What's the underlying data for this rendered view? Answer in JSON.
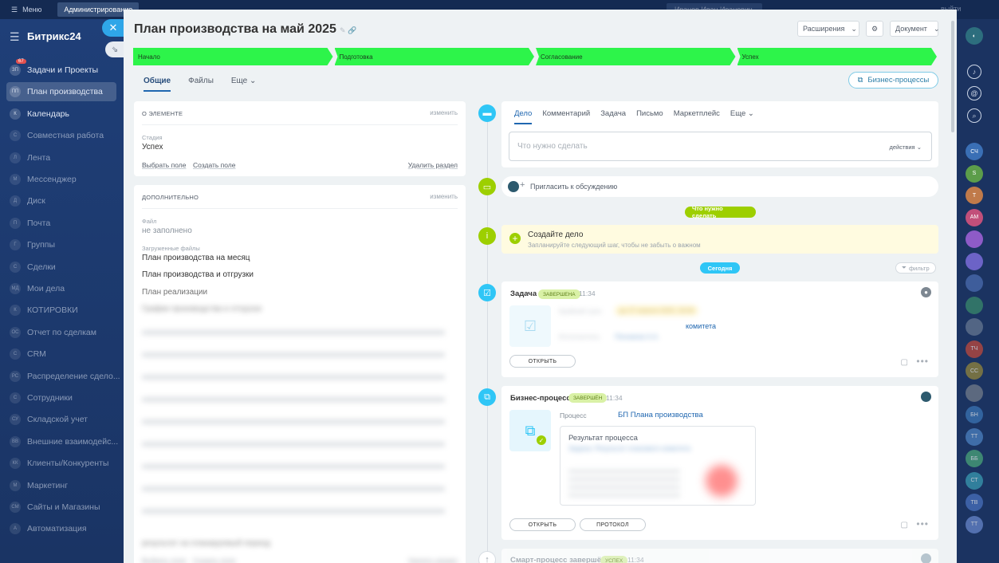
{
  "topbar": {
    "menu": "Меню",
    "admin": "Администрирование",
    "user": "Иванов Иван Иванович",
    "right_text": "выйти"
  },
  "leftnav": {
    "logo": "Битрикс24",
    "items": [
      {
        "label": "Задачи и Проекты",
        "badge": "67",
        "icon": "ЗП"
      },
      {
        "label": "План производства",
        "icon": "ПП",
        "active": true
      },
      {
        "label": "Календарь",
        "icon": "К"
      },
      {
        "label": "Совместная работа",
        "icon": "С"
      },
      {
        "label": "Лента",
        "icon": "Л"
      },
      {
        "label": "Мессенджер",
        "icon": "М"
      },
      {
        "label": "Диск",
        "icon": "Д"
      },
      {
        "label": "Почта",
        "icon": "П"
      },
      {
        "label": "Группы",
        "icon": "Г"
      },
      {
        "label": "Сделки",
        "icon": "С"
      },
      {
        "label": "Мои дела",
        "icon": "МД"
      },
      {
        "label": "КОТИРОВКИ",
        "icon": "К"
      },
      {
        "label": "Отчет по сделкам",
        "icon": "ОС"
      },
      {
        "label": "CRM",
        "icon": "C"
      },
      {
        "label": "Распределение сдело...",
        "icon": "РС"
      },
      {
        "label": "Сотрудники",
        "icon": "С"
      },
      {
        "label": "Складской учет",
        "icon": "СУ"
      },
      {
        "label": "Внешние взаимодейс...",
        "icon": "ВВ"
      },
      {
        "label": "Клиенты/Конкуренты",
        "icon": "КК"
      },
      {
        "label": "Маркетинг",
        "icon": "М"
      },
      {
        "label": "Сайты и Магазины",
        "icon": "СМ"
      },
      {
        "label": "Автоматизация",
        "icon": "А"
      }
    ]
  },
  "header": {
    "title": "План производства на май 2025",
    "ext_btn": "Расширения",
    "doc_btn": "Документ"
  },
  "stages": [
    "Начало",
    "Подготовка",
    "Согласование",
    "Успех"
  ],
  "tabs": {
    "general": "Общие",
    "files": "Файлы",
    "more": "Еще"
  },
  "bp_button": "Бизнес-процессы",
  "about": {
    "header": "О ЭЛЕМЕНТЕ",
    "edit": "изменить",
    "stage_label": "Стадия",
    "stage_value": "Успех",
    "choose": "Выбрать поле",
    "create": "Создать поле",
    "delete": "Удалить раздел"
  },
  "extra": {
    "header": "ДОПОЛНИТЕЛЬНО",
    "edit": "изменить",
    "file_label": "Файл",
    "file_value": "не заполнено",
    "uploaded_label": "Загруженные файлы",
    "files": [
      "План производства на месяц",
      "План производства и отгрузки",
      "План реализации",
      "График производства и отгрузок"
    ],
    "blur_tail": "результат на планируемый период",
    "choose": "Выбрать поле",
    "create": "Создать поле",
    "delete": "Удалить раздел"
  },
  "todo": {
    "tabs": [
      "Дело",
      "Комментарий",
      "Задача",
      "Письмо",
      "Маркетплейс",
      "Еще"
    ],
    "placeholder": "Что нужно сделать",
    "actions": "действия"
  },
  "invite": "Пригласить к обсуждению",
  "todo_pill": "Что нужно сделать",
  "create_deal": {
    "title": "Создайте дело",
    "subtitle": "Запланируйте следующий шаг, чтобы не забыть о важном"
  },
  "today_pill": "Сегодня",
  "filter": "фильтр",
  "task_card": {
    "title": "Задача",
    "status": "ЗАВЕРШЕНА",
    "time": "11:34",
    "deadline_label": "Крайний срок",
    "deadline_value": "до 27 апреля 2025, 18:00",
    "link": "комитета",
    "resp_label": "Исполнитель",
    "resp_value": "Печников А.А.",
    "open": "ОТКРЫТЬ"
  },
  "bp_card": {
    "title": "Бизнес-процесс",
    "status": "ЗАВЕРШЁН",
    "time": "11:34",
    "process_label": "Процесс",
    "process_value": "БП Плана производства",
    "result_title": "Результат процесса",
    "result_sub": "Задача: Результат планового комитета",
    "open": "ОТКРЫТЬ",
    "protocol": "ПРОТОКОЛ"
  },
  "smart_card": {
    "title": "Смарт-процесс завершён",
    "status": "УСПЕХ",
    "time": "11:34"
  },
  "rightbar": {
    "avatars": [
      {
        "t": "СЧ",
        "c": "#3a6fb5"
      },
      {
        "t": "S",
        "c": "#5c9d4a"
      },
      {
        "t": "Т",
        "c": "#c07a4a"
      },
      {
        "t": "АМ",
        "c": "#c24f7a"
      },
      {
        "t": "",
        "c": "#8e5bc7"
      },
      {
        "t": "",
        "c": "#6c63c7"
      },
      {
        "t": "",
        "c": "#4d6fb3"
      },
      {
        "t": "",
        "c": "#3b8e6b"
      },
      {
        "t": "",
        "c": "#6a7b93"
      },
      {
        "t": "ТЧ",
        "c": "#c94b3a"
      },
      {
        "t": "СС",
        "c": "#9a8a3a"
      },
      {
        "t": "",
        "c": "#77808b"
      },
      {
        "t": "БН",
        "c": "#3d78b8"
      },
      {
        "t": "ТТ",
        "c": "#4f86c6"
      },
      {
        "t": "ББ",
        "c": "#4cab7a"
      },
      {
        "t": "СТ",
        "c": "#3ba0b5"
      },
      {
        "t": "ТВ",
        "c": "#4a74c2"
      },
      {
        "t": "ТТ",
        "c": "#6b8bd0"
      }
    ]
  }
}
